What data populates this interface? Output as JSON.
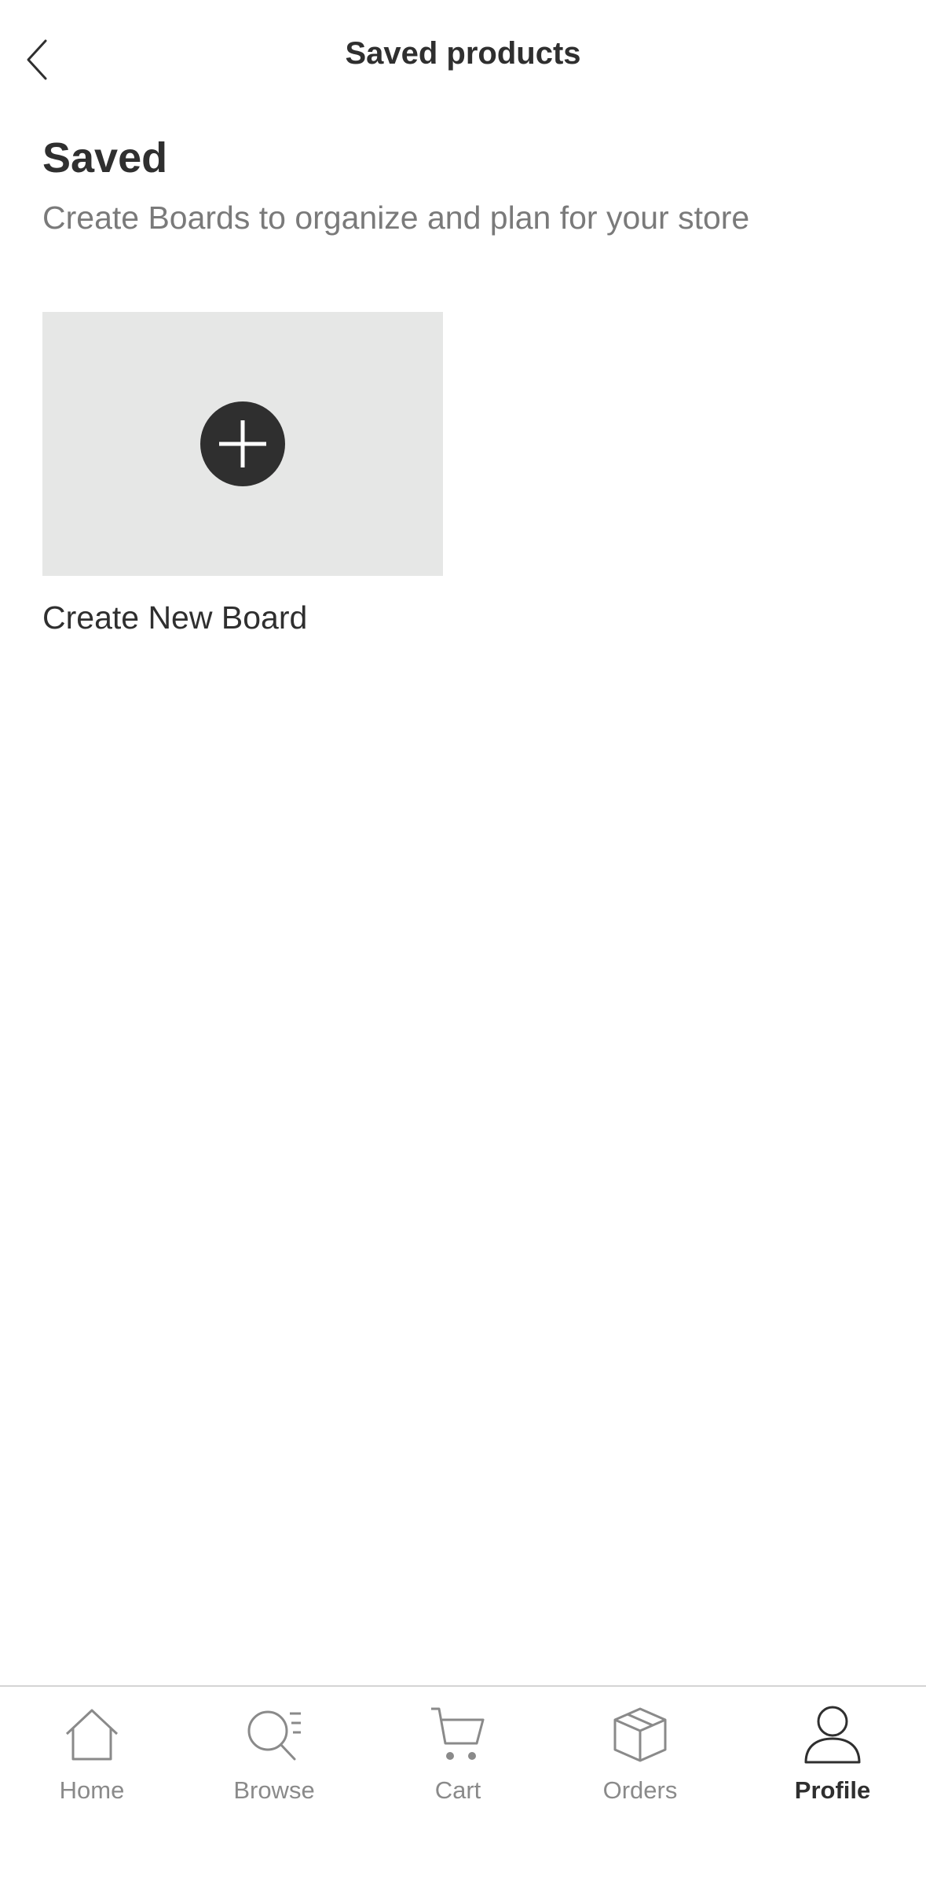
{
  "header": {
    "title": "Saved products"
  },
  "main": {
    "title": "Saved",
    "subtitle": "Create Boards to organize and plan for your store",
    "create_board_label": "Create New Board"
  },
  "tabbar": {
    "active": "profile",
    "items": [
      {
        "id": "home",
        "label": "Home",
        "icon": "home-icon"
      },
      {
        "id": "browse",
        "label": "Browse",
        "icon": "search-icon"
      },
      {
        "id": "cart",
        "label": "Cart",
        "icon": "cart-icon"
      },
      {
        "id": "orders",
        "label": "Orders",
        "icon": "box-icon"
      },
      {
        "id": "profile",
        "label": "Profile",
        "icon": "person-icon"
      }
    ]
  },
  "colors": {
    "text_primary": "#2f2f2f",
    "text_secondary": "#7a7a7a",
    "card_bg": "#e6e7e6",
    "plus_circle": "#2f2f2f",
    "tab_inactive": "#8a8a8a"
  }
}
